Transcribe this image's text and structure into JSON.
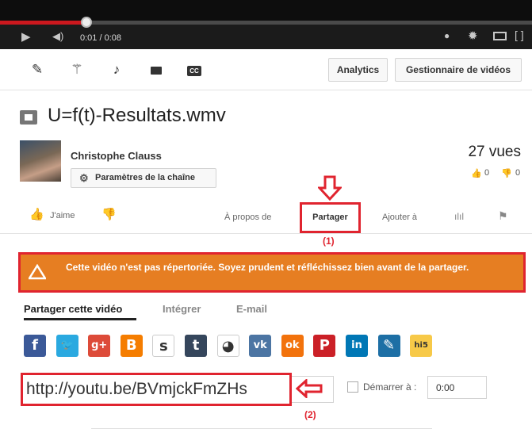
{
  "player": {
    "time": "0:01 / 0:08",
    "progress_fraction": 0.016,
    "icons": [
      "play-icon",
      "volume-icon",
      "annotations-icon",
      "settings-icon",
      "theater-icon",
      "fullscreen-icon"
    ]
  },
  "toolbar": {
    "tools": [
      "pencil-icon",
      "magic-wand-icon",
      "music-note-icon",
      "comment-icon",
      "captions-icon"
    ],
    "captions_label": "CC",
    "analytics": "Analytics",
    "manager": "Gestionnaire de vidéos"
  },
  "video": {
    "title": "U=f(t)-Resultats.wmv",
    "owner": "Christophe Clauss",
    "owner_sep": "·",
    "settings": "Paramètres de la chaîne",
    "views": "27 vues",
    "likes": "0",
    "dislikes": "0"
  },
  "actions": {
    "like": "J'aime",
    "about": "À propos de",
    "share": "Partager",
    "add_to": "Ajouter à",
    "annotation_1": "(1)"
  },
  "warning": {
    "text": "Cette vidéo n'est pas répertoriée. Soyez prudent et réfléchissez bien avant de la partager."
  },
  "share": {
    "tabs": [
      "Partager cette vidéo",
      "Intégrer",
      "E-mail"
    ],
    "networks": [
      {
        "name": "facebook",
        "glyph": "f",
        "color": "#3b5998"
      },
      {
        "name": "twitter",
        "glyph": "🐦",
        "color": "#2aa9e0"
      },
      {
        "name": "google-plus",
        "glyph": "g+",
        "color": "#dd4b39"
      },
      {
        "name": "blogger",
        "glyph": "B",
        "color": "#f57d00"
      },
      {
        "name": "stumbleupon",
        "glyph": "s",
        "color": "#ffffff"
      },
      {
        "name": "tumblr",
        "glyph": "t",
        "color": "#35465c"
      },
      {
        "name": "reddit",
        "glyph": "◕",
        "color": "#ffffff"
      },
      {
        "name": "vk",
        "glyph": "vk",
        "color": "#4c75a3"
      },
      {
        "name": "odnoklassniki",
        "glyph": "ok",
        "color": "#f2720c"
      },
      {
        "name": "pinterest",
        "glyph": "P",
        "color": "#cb2027"
      },
      {
        "name": "linkedin",
        "glyph": "in",
        "color": "#0077b5"
      },
      {
        "name": "livejournal",
        "glyph": "✎",
        "color": "#1d6fa5"
      },
      {
        "name": "hi5",
        "glyph": "hi5",
        "color": "#f7c948"
      }
    ],
    "url": "http://youtu.be/BVmjckFmZHs",
    "start_label": "Démarrer à :",
    "start_value": "0:00",
    "annotation_2": "(2)"
  }
}
